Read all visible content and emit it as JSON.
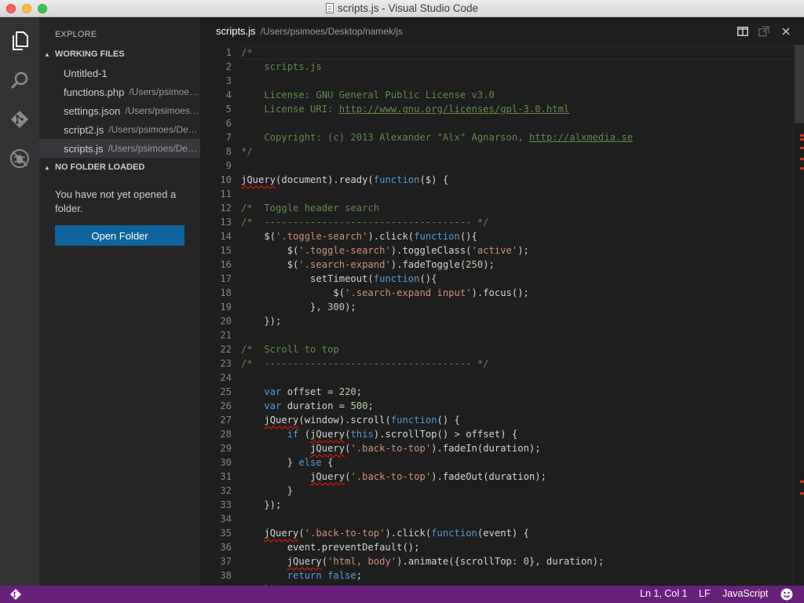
{
  "window": {
    "title": "scripts.js - Visual Studio Code"
  },
  "sidebar": {
    "title": "EXPLORE",
    "working_files": {
      "header": "WORKING FILES",
      "items": [
        {
          "name": "Untitled-1",
          "path": ""
        },
        {
          "name": "functions.php",
          "path": "/Users/psimoes/Desktop/namek"
        },
        {
          "name": "settings.json",
          "path": "/Users/psimoes/Library/Application Support"
        },
        {
          "name": "script2.js",
          "path": "/Users/psimoes/Desktop/namek/js"
        },
        {
          "name": "scripts.js",
          "path": "/Users/psimoes/Desktop/namek/js",
          "selected": true
        }
      ]
    },
    "no_folder": {
      "header": "NO FOLDER LOADED",
      "message": "You have not yet opened a folder.",
      "button": "Open Folder"
    }
  },
  "editor": {
    "tab_name": "scripts.js",
    "tab_path": "/Users/psimoes/Desktop/namek/js",
    "lines": [
      [
        [
          "c",
          "/*"
        ]
      ],
      [
        [
          "c",
          "    scripts.js"
        ]
      ],
      [
        [
          "c",
          ""
        ]
      ],
      [
        [
          "c",
          "    License: GNU General Public License v3.0"
        ]
      ],
      [
        [
          "c",
          "    License URI: "
        ],
        [
          "l",
          "http://www.gnu.org/licenses/gpl-3.0.html"
        ]
      ],
      [
        [
          "c",
          ""
        ]
      ],
      [
        [
          "c",
          "    Copyright: (c) 2013 Alexander \"Alx\" Agnarson, "
        ],
        [
          "l",
          "http://alxmedia.se"
        ]
      ],
      [
        [
          "c",
          "*/"
        ]
      ],
      [],
      [
        [
          "w",
          "jQuery"
        ],
        [
          "p",
          "(document).ready("
        ],
        [
          "k",
          "function"
        ],
        [
          "p",
          "($) {"
        ]
      ],
      [],
      [
        [
          "c",
          "/*  Toggle header search"
        ]
      ],
      [
        [
          "c",
          "/*  ------------------------------------ */"
        ]
      ],
      [
        [
          "p",
          "    $("
        ],
        [
          "s",
          "'.toggle-search'"
        ],
        [
          "p",
          ").click("
        ],
        [
          "k",
          "function"
        ],
        [
          "p",
          "(){"
        ]
      ],
      [
        [
          "p",
          "        $("
        ],
        [
          "s",
          "'.toggle-search'"
        ],
        [
          "p",
          ").toggleClass("
        ],
        [
          "s",
          "'active'"
        ],
        [
          "p",
          ");"
        ]
      ],
      [
        [
          "p",
          "        $("
        ],
        [
          "s",
          "'.search-expand'"
        ],
        [
          "p",
          ").fadeToggle("
        ],
        [
          "n",
          "250"
        ],
        [
          "p",
          ");"
        ]
      ],
      [
        [
          "p",
          "            setTimeout("
        ],
        [
          "k",
          "function"
        ],
        [
          "p",
          "(){"
        ]
      ],
      [
        [
          "p",
          "                $("
        ],
        [
          "s",
          "'.search-expand input'"
        ],
        [
          "p",
          ").focus();"
        ]
      ],
      [
        [
          "p",
          "            }, "
        ],
        [
          "n",
          "300"
        ],
        [
          "p",
          ");"
        ]
      ],
      [
        [
          "p",
          "    });"
        ]
      ],
      [],
      [
        [
          "c",
          "/*  Scroll to top"
        ]
      ],
      [
        [
          "c",
          "/*  ------------------------------------ */"
        ]
      ],
      [],
      [
        [
          "k",
          "    var"
        ],
        [
          "p",
          " offset = "
        ],
        [
          "n",
          "220"
        ],
        [
          "p",
          ";"
        ]
      ],
      [
        [
          "k",
          "    var"
        ],
        [
          "p",
          " duration = "
        ],
        [
          "n",
          "500"
        ],
        [
          "p",
          ";"
        ]
      ],
      [
        [
          "p",
          "    "
        ],
        [
          "w",
          "jQuery"
        ],
        [
          "p",
          "(window).scroll("
        ],
        [
          "k",
          "function"
        ],
        [
          "p",
          "() {"
        ]
      ],
      [
        [
          "k",
          "        if"
        ],
        [
          "p",
          " ("
        ],
        [
          "w",
          "jQuery"
        ],
        [
          "p",
          "("
        ],
        [
          "k",
          "this"
        ],
        [
          "p",
          ").scrollTop() > offset) {"
        ]
      ],
      [
        [
          "p",
          "            "
        ],
        [
          "w",
          "jQuery"
        ],
        [
          "p",
          "("
        ],
        [
          "s",
          "'.back-to-top'"
        ],
        [
          "p",
          ").fadeIn(duration);"
        ]
      ],
      [
        [
          "p",
          "        } "
        ],
        [
          "k",
          "else"
        ],
        [
          "p",
          " {"
        ]
      ],
      [
        [
          "p",
          "            "
        ],
        [
          "w",
          "jQuery"
        ],
        [
          "p",
          "("
        ],
        [
          "s",
          "'.back-to-top'"
        ],
        [
          "p",
          ").fadeOut(duration);"
        ]
      ],
      [
        [
          "p",
          "        }"
        ]
      ],
      [
        [
          "p",
          "    });"
        ]
      ],
      [],
      [
        [
          "p",
          "    "
        ],
        [
          "w",
          "jQuery"
        ],
        [
          "p",
          "("
        ],
        [
          "s",
          "'.back-to-top'"
        ],
        [
          "p",
          ").click("
        ],
        [
          "k",
          "function"
        ],
        [
          "p",
          "(event) {"
        ]
      ],
      [
        [
          "p",
          "        event.preventDefault();"
        ]
      ],
      [
        [
          "p",
          "        "
        ],
        [
          "w",
          "jQuery"
        ],
        [
          "p",
          "("
        ],
        [
          "s",
          "'html, body'"
        ],
        [
          "p",
          ").animate({scrollTop: "
        ],
        [
          "n",
          "0"
        ],
        [
          "p",
          "}, duration);"
        ]
      ],
      [
        [
          "k",
          "        return"
        ],
        [
          "p",
          " "
        ],
        [
          "k",
          "false"
        ],
        [
          "p",
          ";"
        ]
      ],
      [
        [
          "p",
          "    });"
        ]
      ]
    ]
  },
  "statusbar": {
    "position": "Ln 1, Col 1",
    "eol": "LF",
    "language": "JavaScript"
  },
  "icons": {
    "activity": [
      "explorer-icon",
      "search-icon",
      "git-icon",
      "debug-icon"
    ],
    "header": [
      "split-editor-icon",
      "open-changes-icon",
      "close-icon"
    ],
    "status": [
      "git-branch-icon",
      "feedback-smiley-icon"
    ]
  },
  "colors": {
    "statusbar": "#68217a",
    "button": "#0e639c",
    "comment": "#608b4e",
    "string": "#ce9178",
    "keyword": "#569cd6",
    "number": "#b5cea8"
  }
}
